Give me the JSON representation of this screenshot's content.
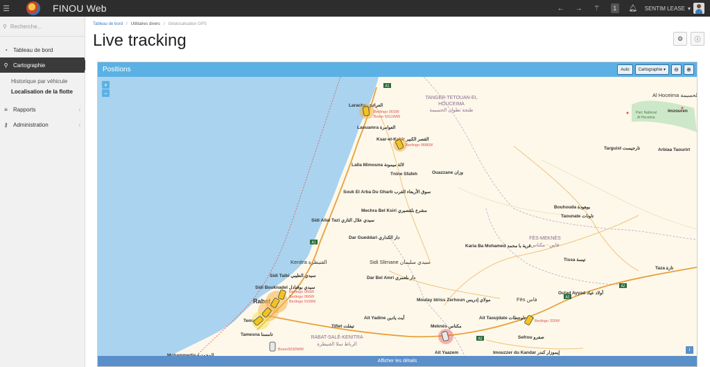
{
  "app": {
    "title": "FINOU Web",
    "user_name": "SENTIM LEASE",
    "notification_count": "1",
    "icons": [
      "back-arrow-icon",
      "forward-arrow-icon",
      "magic-wand-icon",
      "bell-icon"
    ]
  },
  "sidebar": {
    "search_placeholder": "Recherche...",
    "items": [
      {
        "label": "Tableau de bord",
        "icon": "dashboard-icon"
      },
      {
        "label": "Cartographie",
        "icon": "map-marker-icon",
        "active": true
      },
      {
        "label": "Rapports",
        "icon": "list-icon"
      },
      {
        "label": "Administration",
        "icon": "key-icon"
      }
    ],
    "subitems": [
      {
        "label": "Historique par véhicule"
      },
      {
        "label": "Localisation de la flotte",
        "current": true
      }
    ]
  },
  "breadcrumb": [
    "Tableau de bord",
    "Utilitaires divers",
    "Géolocalisation GPS"
  ],
  "page": {
    "title": "Live tracking"
  },
  "panel": {
    "title": "Positions",
    "auto_label": "Auto",
    "cartography_label": "Cartographie",
    "details_label": "Afficher les détails"
  },
  "map": {
    "regions": [
      {
        "name": "TANGER-TETOUAN-EL HOUCEIMA",
        "arabic": "طنجة تطوان الحسيمة"
      },
      {
        "name": "FÈS-MEKNÈS",
        "arabic": "فاس - مكناس"
      },
      {
        "name": "RABAT-SALÉ-KENITRA",
        "arabic": "الرباط سلا القنيطرة"
      }
    ],
    "places": [
      {
        "name": "Larache",
        "arabic": "العرائش"
      },
      {
        "name": "Laouamra",
        "arabic": "العوامرة"
      },
      {
        "name": "Ksar-el-Kebir",
        "arabic": "القصر الكبير"
      },
      {
        "name": "Lalla Mimouna",
        "arabic": "لالة ميمونة"
      },
      {
        "name": "Tnine Sfafeh"
      },
      {
        "name": "Ouazzane",
        "arabic": "وزان"
      },
      {
        "name": "Souk El Arba Du Gharb",
        "arabic": "سوق الأربعاء الغرب"
      },
      {
        "name": "Mechra Bel Ksiri",
        "arabic": "مشرع بلقصيري"
      },
      {
        "name": "Sidi Allal Tazi",
        "arabic": "سيدي علال التازي"
      },
      {
        "name": "Dar Gueddari",
        "arabic": "دار الكداري"
      },
      {
        "name": "Sidi Slimane",
        "arabic": "سيدي سليمان"
      },
      {
        "name": "Kenitra",
        "arabic": "القنيطرة"
      },
      {
        "name": "Sidi Taibi",
        "arabic": "سيدي الطيبي"
      },
      {
        "name": "Sidi Bouknadel",
        "arabic": "سيدي بوقنادل"
      },
      {
        "name": "Dar Bel Amri",
        "arabic": "دار بلعمري"
      },
      {
        "name": "Moulay Idriss Zerhoun",
        "arabic": "مولاي إدريس"
      },
      {
        "name": "Ait Yadine",
        "arabic": "أيت يادين"
      },
      {
        "name": "Tiflet",
        "arabic": "تيفلت"
      },
      {
        "name": "Rabat"
      },
      {
        "name": "Temara"
      },
      {
        "name": "Tamesna",
        "arabic": "تامسنا"
      },
      {
        "name": "Mohammedia",
        "arabic": "المحمدية"
      },
      {
        "name": "Meknès",
        "arabic": "مكناس"
      },
      {
        "name": "Ait Taoujdate",
        "arabic": "عين تاوجطات"
      },
      {
        "name": "Fès",
        "arabic": "فاس"
      },
      {
        "name": "Sefrou",
        "arabic": "صفرو"
      },
      {
        "name": "Ait Yaazem"
      },
      {
        "name": "Imouzzer du Kandar",
        "arabic": "إيموزار كندر"
      },
      {
        "name": "Karia Ba Mohamed",
        "arabic": "قرية با محمد"
      },
      {
        "name": "Bouhouda",
        "arabic": "بوهودة"
      },
      {
        "name": "Taounate",
        "arabic": "تاونات"
      },
      {
        "name": "Tissa",
        "arabic": "تيسة"
      },
      {
        "name": "Oulad Ayyad",
        "arabic": "أولاد عياد"
      },
      {
        "name": "Taza",
        "arabic": "تازة"
      },
      {
        "name": "Targuist",
        "arabic": "تارجيست"
      },
      {
        "name": "Arbiaa Taourirt"
      },
      {
        "name": "Al Hoceima",
        "arabic": "الحسيمة"
      },
      {
        "name": "Imzouren"
      },
      {
        "name": "Parc National Al Hoceima"
      }
    ],
    "roads": [
      "A1",
      "A2"
    ],
    "vehicles": [
      {
        "label": "Berlingo 06SW"
      },
      {
        "label": "Boxer 5011WW"
      },
      {
        "label": "Berlingo 0686W"
      },
      {
        "label": "Berlingo 065W"
      },
      {
        "label": "Berlingo 066W"
      },
      {
        "label": "Berlingo 326W"
      },
      {
        "label": "Boxer5030WW"
      },
      {
        "label": "Berlingo 01WW"
      }
    ]
  }
}
